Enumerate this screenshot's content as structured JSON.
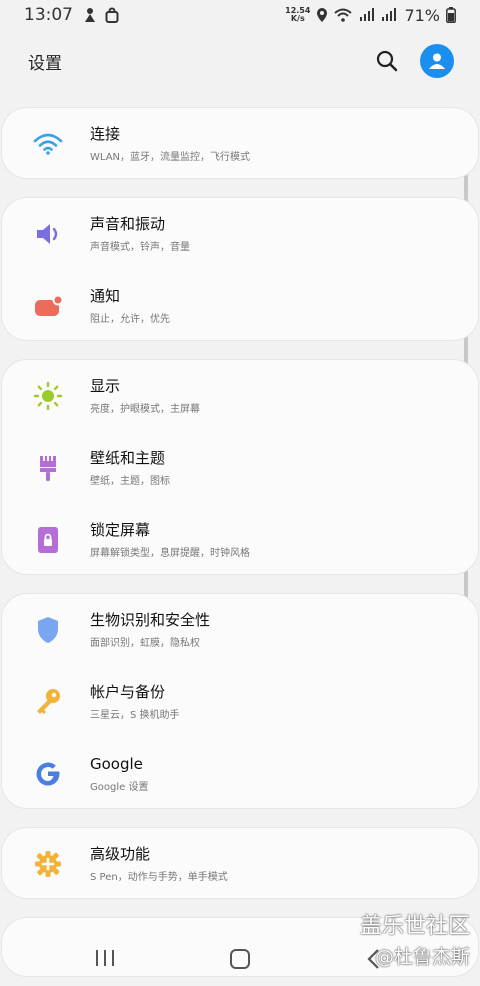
{
  "status": {
    "time": "13:07",
    "speed_top": "12.54",
    "speed_bottom": "K/s",
    "battery": "71%"
  },
  "header": {
    "title": "设置"
  },
  "groups": [
    {
      "items": [
        {
          "title": "连接",
          "sub": "WLAN，蓝牙，流量监控，飞行模式",
          "icon": "wifi-icon",
          "color": "#3aa0e8"
        }
      ]
    },
    {
      "items": [
        {
          "title": "声音和振动",
          "sub": "声音模式，铃声，音量",
          "icon": "speaker-icon",
          "color": "#7b6fe0"
        },
        {
          "title": "通知",
          "sub": "阻止，允许，优先",
          "icon": "notification-icon",
          "color": "#ec6b5a"
        }
      ]
    },
    {
      "items": [
        {
          "title": "显示",
          "sub": "亮度，护眼模式，主屏幕",
          "icon": "sun-icon",
          "color": "#9ccc2c"
        },
        {
          "title": "壁纸和主题",
          "sub": "壁纸，主题，图标",
          "icon": "brush-icon",
          "color": "#b46ed6"
        },
        {
          "title": "锁定屏幕",
          "sub": "屏幕解锁类型，息屏提醒，时钟风格",
          "icon": "lock-screen-icon",
          "color": "#b46ed6"
        }
      ]
    },
    {
      "items": [
        {
          "title": "生物识别和安全性",
          "sub": "面部识别，虹膜，隐私权",
          "icon": "shield-icon",
          "color": "#7aa5f0"
        },
        {
          "title": "帐户与备份",
          "sub": "三星云，S 换机助手",
          "icon": "key-icon",
          "color": "#f2b33a"
        },
        {
          "title": "Google",
          "sub": "Google 设置",
          "icon": "google-icon",
          "color": "#4a7fe0"
        }
      ]
    },
    {
      "items": [
        {
          "title": "高级功能",
          "sub": "S Pen，动作与手势，单手模式",
          "icon": "advanced-gear-plus-icon",
          "color": "#f2b33a"
        }
      ]
    }
  ],
  "watermark": {
    "line1": "盖乐世社区",
    "line2": "@杜鲁杰斯"
  }
}
